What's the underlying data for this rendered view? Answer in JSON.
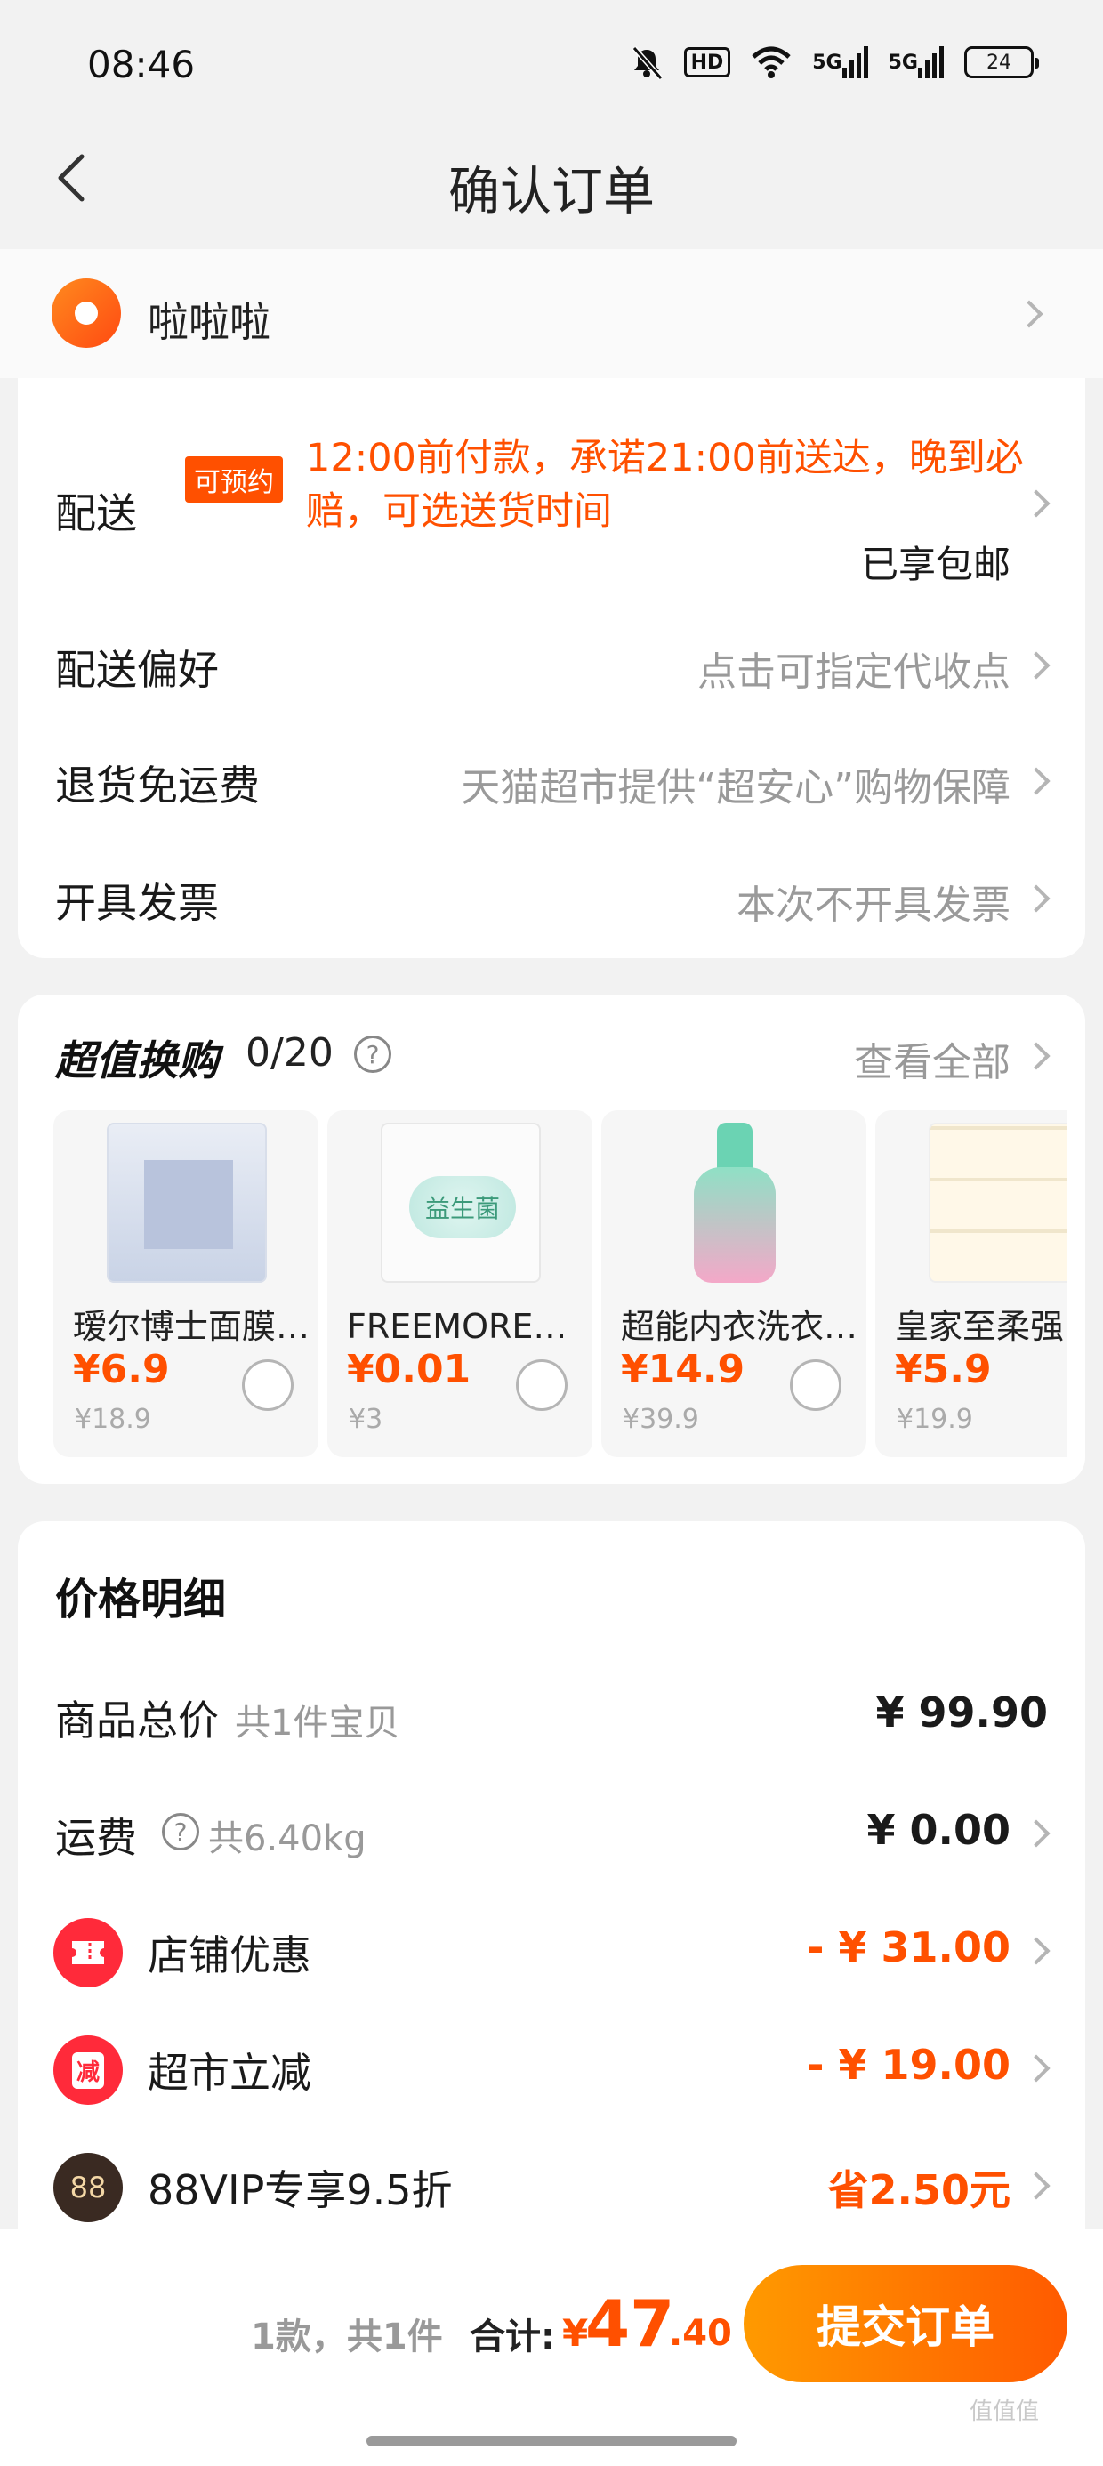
{
  "status_bar": {
    "time": "08:46",
    "hd_label": "HD",
    "net1": "5G",
    "net2": "5G",
    "battery": "24"
  },
  "nav": {
    "title": "确认订单"
  },
  "address": {
    "name": "啦啦啦"
  },
  "order_card": {
    "delivery": {
      "label": "配送",
      "tag": "可预约",
      "text": "12:00前付款，承诺21:00前送达，晚到必赔，可选送货时间",
      "free_shipping": "已享包邮"
    },
    "preference": {
      "label": "配送偏好",
      "value": "点击可指定代收点"
    },
    "return": {
      "label": "退货免运费",
      "value": "天猫超市提供“超安心”购物保障"
    },
    "invoice": {
      "label": "开具发票",
      "value": "本次不开具发票"
    }
  },
  "exchange": {
    "title": "超值换购",
    "count": "0/20",
    "help": "?",
    "view_all": "查看全部",
    "products": [
      {
        "name": "瑷尔博士面膜…",
        "price": "¥6.9",
        "orig": "¥18.9"
      },
      {
        "name": "FREEMORE自…",
        "price": "¥0.01",
        "orig": "¥3"
      },
      {
        "name": "超能内衣洗衣…",
        "price": "¥14.9",
        "orig": "¥39.9"
      },
      {
        "name": "皇家至柔强",
        "price": "¥5.9",
        "orig": "¥19.9"
      }
    ]
  },
  "price_detail": {
    "title": "价格明细",
    "goods_total": {
      "label": "商品总价",
      "sub": "共1件宝贝",
      "amount": "¥ 99.90"
    },
    "shipping": {
      "label": "运费",
      "help": "?",
      "sub": "共6.40kg",
      "amount": "¥ 0.00"
    },
    "shop_discount": {
      "label": "店铺优惠",
      "amount": "- ¥ 31.00"
    },
    "market_reduce": {
      "label": "超市立减",
      "badge": "减",
      "amount": "- ¥ 19.00"
    },
    "vip": {
      "label": "88VIP专享9.5折",
      "badge": "88",
      "amount": "省2.50元"
    }
  },
  "bottom_bar": {
    "count": "1款，共1件",
    "total_label": "合计:",
    "yen": "¥",
    "total_int": "47",
    "total_dec": ".40",
    "submit": "提交订单"
  },
  "watermark": "值值值",
  "colors": {
    "accent": "#ff5000",
    "button_start": "#ff9a00",
    "button_end": "#ff5a00",
    "vip_badge": "#3a2a22"
  }
}
